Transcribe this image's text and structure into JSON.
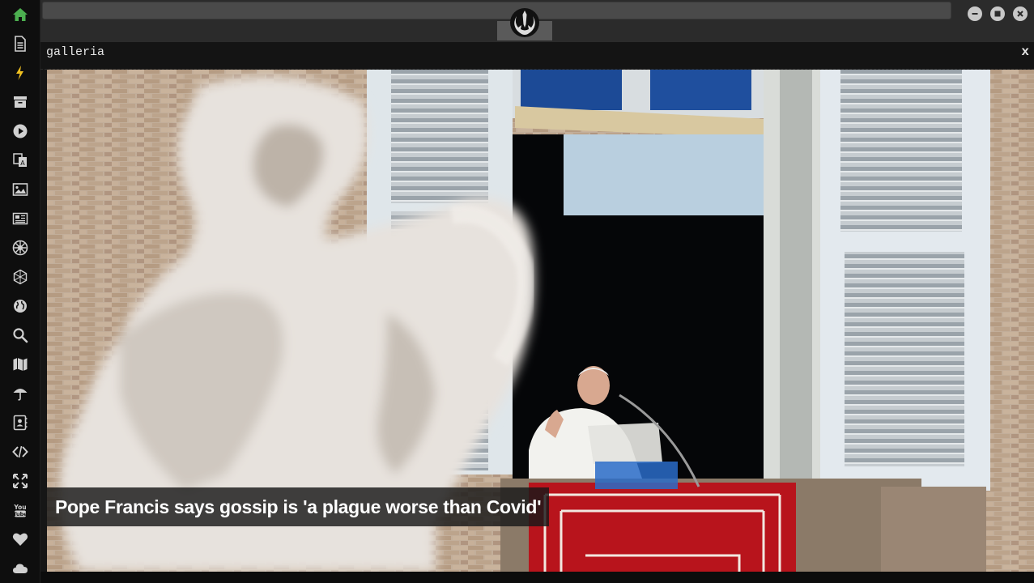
{
  "window": {
    "header_title": "galleria",
    "close_label": "x"
  },
  "sidebar": {
    "items": [
      {
        "name": "home-icon",
        "color": "#4caf50"
      },
      {
        "name": "document-icon",
        "color": "#d0d0d0"
      },
      {
        "name": "lightning-icon",
        "color": "#f0c020"
      },
      {
        "name": "archive-icon",
        "color": "#d0d0d0"
      },
      {
        "name": "play-icon",
        "color": "#d0d0d0"
      },
      {
        "name": "translate-icon",
        "color": "#d0d0d0"
      },
      {
        "name": "image-icon",
        "color": "#d0d0d0"
      },
      {
        "name": "newspaper-icon",
        "color": "#d0d0d0"
      },
      {
        "name": "empire-icon",
        "color": "#d0d0d0"
      },
      {
        "name": "hexagon-network-icon",
        "color": "#d0d0d0"
      },
      {
        "name": "globe-icon",
        "color": "#d0d0d0"
      },
      {
        "name": "search-icon",
        "color": "#d0d0d0"
      },
      {
        "name": "map-icon",
        "color": "#d0d0d0"
      },
      {
        "name": "umbrella-icon",
        "color": "#d0d0d0"
      },
      {
        "name": "contacts-icon",
        "color": "#d0d0d0"
      },
      {
        "name": "code-icon",
        "color": "#d0d0d0"
      },
      {
        "name": "fullscreen-icon",
        "color": "#d0d0d0"
      },
      {
        "name": "youtube-icon",
        "color": "#d0d0d0"
      },
      {
        "name": "heart-icon",
        "color": "#d0d0d0"
      },
      {
        "name": "cloud-icon",
        "color": "#d0d0d0"
      }
    ]
  },
  "gallery": {
    "caption": "Pope Francis says gossip is 'a plague worse than Covid'"
  }
}
